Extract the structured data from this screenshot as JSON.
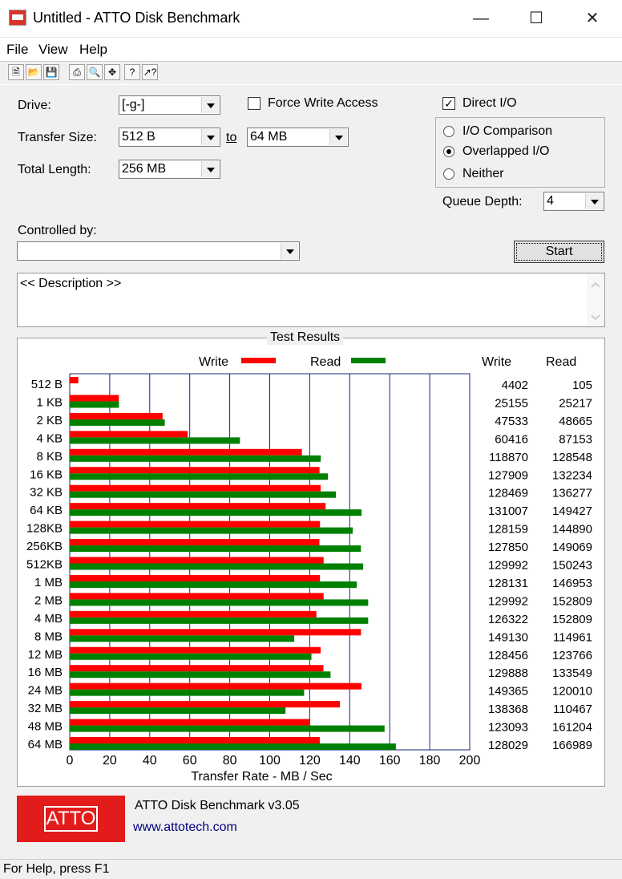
{
  "window": {
    "title": "Untitled - ATTO Disk Benchmark"
  },
  "menu": [
    "File",
    "View",
    "Help"
  ],
  "toolbar_icons": [
    "new-icon",
    "open-icon",
    "save-icon",
    "print-icon",
    "print-preview-icon",
    "move-icon",
    "help-icon",
    "context-help-icon"
  ],
  "form": {
    "drive_label": "Drive:",
    "drive_value": "[-g-]",
    "transfer_size_label": "Transfer Size:",
    "transfer_from": "512 B",
    "to_label": "to",
    "transfer_to": "64 MB",
    "total_length_label": "Total Length:",
    "total_length": "256 MB",
    "force_write_label": "Force Write Access",
    "direct_io_label": "Direct I/O",
    "io_comparison_label": "I/O Comparison",
    "overlapped_io_label": "Overlapped I/O",
    "neither_label": "Neither",
    "queue_depth_label": "Queue Depth:",
    "queue_depth": "4",
    "controlled_by_label": "Controlled by:",
    "controlled_by": "",
    "start_label": "Start",
    "description": "<< Description >>"
  },
  "results": {
    "title": "Test Results",
    "legend_write": "Write",
    "legend_read": "Read",
    "col_write": "Write",
    "col_read": "Read",
    "xlabel": "Transfer Rate - MB / Sec"
  },
  "chart_data": {
    "type": "bar",
    "orientation": "horizontal",
    "categories": [
      "512 B",
      "1 KB",
      "2 KB",
      "4 KB",
      "8 KB",
      "16 KB",
      "32 KB",
      "64 KB",
      "128KB",
      "256KB",
      "512KB",
      "1 MB",
      "2 MB",
      "4 MB",
      "8 MB",
      "12 MB",
      "16 MB",
      "24 MB",
      "32 MB",
      "48 MB",
      "64 MB"
    ],
    "series": [
      {
        "name": "Write",
        "color": "#ff0000",
        "values": [
          4402,
          25155,
          47533,
          60416,
          118870,
          127909,
          128469,
          131007,
          128159,
          127850,
          129992,
          128131,
          129992,
          126322,
          149130,
          128456,
          129888,
          149365,
          138368,
          123093,
          128029
        ]
      },
      {
        "name": "Read",
        "color": "#008000",
        "values": [
          105,
          25217,
          48665,
          87153,
          128548,
          132234,
          136277,
          149427,
          144890,
          149069,
          150243,
          146953,
          152809,
          152809,
          114961,
          123766,
          133549,
          120010,
          110467,
          161204,
          166989
        ]
      }
    ],
    "x_ticks": [
      "0",
      "20",
      "40",
      "60",
      "80",
      "100",
      "120",
      "140",
      "160",
      "180",
      "200"
    ],
    "xlim": [
      0,
      200
    ],
    "xlabel": "Transfer Rate - MB / Sec",
    "grid": true
  },
  "footer": {
    "product": "ATTO Disk Benchmark v3.05",
    "url": "www.attotech.com",
    "logo": "ATTO"
  },
  "status": "For Help, press F1",
  "colors": {
    "write": "#ff0000",
    "read": "#008000",
    "grid": "#1a237e",
    "link": "#00007f",
    "logo_bg": "#e21b1b"
  }
}
